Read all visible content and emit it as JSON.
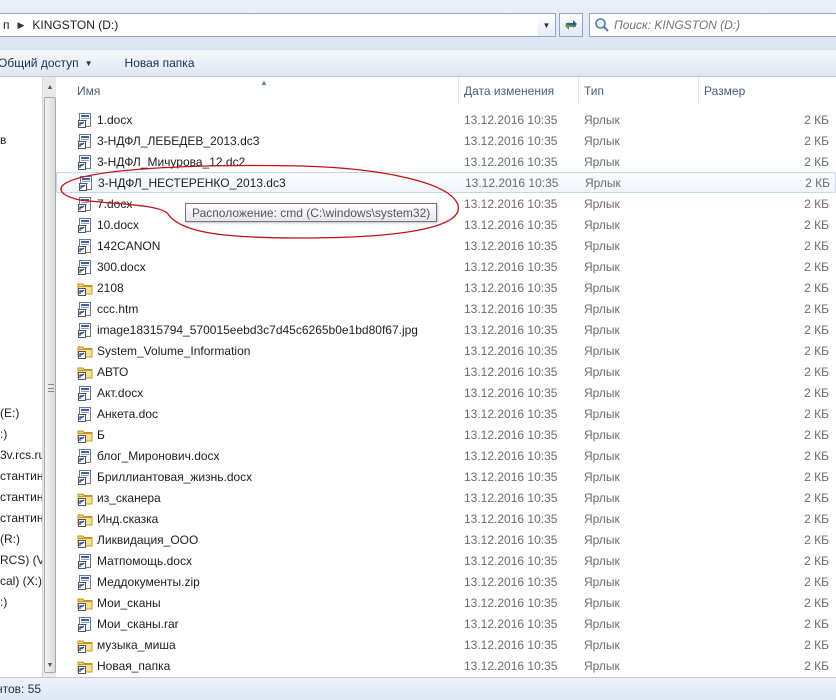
{
  "address": {
    "crumbs": [
      "п",
      "KINGSTON (D:)"
    ]
  },
  "search": {
    "placeholder": "Поиск: KINGSTON (D:)"
  },
  "toolbar": {
    "share_label": "Общий доступ",
    "new_folder_label": "Новая папка"
  },
  "nav": {
    "items": [
      {
        "label": "в",
        "kind": "text"
      },
      {
        "label": "(E:)",
        "kind": "drive"
      },
      {
        "label": ":)",
        "kind": "drive"
      },
      {
        "label": "3v.rcs.ru",
        "kind": "net"
      },
      {
        "label": "стантин",
        "kind": "net"
      },
      {
        "label": "стантин",
        "kind": "net"
      },
      {
        "label": "стантин",
        "kind": "net"
      },
      {
        "label": "(R:)",
        "kind": "drive"
      },
      {
        "label": "RCS) (V:",
        "kind": "drive"
      },
      {
        "label": "cal) (X:)",
        "kind": "drive"
      },
      {
        "label": ":)",
        "kind": "drive"
      }
    ]
  },
  "columns": {
    "name": "Имя",
    "date": "Дата изменения",
    "type": "Тип",
    "size": "Размер"
  },
  "files": [
    {
      "name": "1.docx",
      "date": "13.12.2016 10:35",
      "type": "Ярлык",
      "size": "2 КБ",
      "icon": "doc-shortcut-icon"
    },
    {
      "name": "3-НДФЛ_ЛЕБЕДЕВ_2013.dc3",
      "date": "13.12.2016 10:35",
      "type": "Ярлык",
      "size": "2 КБ",
      "icon": "doc-shortcut-icon"
    },
    {
      "name": "3-НДФЛ_Мичурова_12.dc2",
      "date": "13.12.2016 10:35",
      "type": "Ярлык",
      "size": "2 КБ",
      "icon": "doc-shortcut-icon"
    },
    {
      "name": "3-НДФЛ_НЕСТЕРЕНКО_2013.dc3",
      "date": "13.12.2016 10:35",
      "type": "Ярлык",
      "size": "2 КБ",
      "icon": "doc-shortcut-icon",
      "hover": true
    },
    {
      "name": "7.docx",
      "date": "13.12.2016 10:35",
      "type": "Ярлык",
      "size": "2 КБ",
      "icon": "doc-shortcut-icon"
    },
    {
      "name": "10.docx",
      "date": "13.12.2016 10:35",
      "type": "Ярлык",
      "size": "2 КБ",
      "icon": "doc-shortcut-icon"
    },
    {
      "name": "142CANON",
      "date": "13.12.2016 10:35",
      "type": "Ярлык",
      "size": "2 КБ",
      "icon": "doc-shortcut-icon"
    },
    {
      "name": "300.docx",
      "date": "13.12.2016 10:35",
      "type": "Ярлык",
      "size": "2 КБ",
      "icon": "doc-shortcut-icon"
    },
    {
      "name": "2108",
      "date": "13.12.2016 10:35",
      "type": "Ярлык",
      "size": "2 КБ",
      "icon": "folder-shortcut-icon"
    },
    {
      "name": "ccc.htm",
      "date": "13.12.2016 10:35",
      "type": "Ярлык",
      "size": "2 КБ",
      "icon": "doc-shortcut-icon"
    },
    {
      "name": "image18315794_570015eebd3c7d45c6265b0e1bd80f67.jpg",
      "date": "13.12.2016 10:35",
      "type": "Ярлык",
      "size": "2 КБ",
      "icon": "doc-shortcut-icon"
    },
    {
      "name": "System_Volume_Information",
      "date": "13.12.2016 10:35",
      "type": "Ярлык",
      "size": "2 КБ",
      "icon": "folder-shortcut-icon"
    },
    {
      "name": "АВТО",
      "date": "13.12.2016 10:35",
      "type": "Ярлык",
      "size": "2 КБ",
      "icon": "folder-shortcut-icon"
    },
    {
      "name": "Акт.docx",
      "date": "13.12.2016 10:35",
      "type": "Ярлык",
      "size": "2 КБ",
      "icon": "doc-shortcut-icon"
    },
    {
      "name": "Анкета.doc",
      "date": "13.12.2016 10:35",
      "type": "Ярлык",
      "size": "2 КБ",
      "icon": "doc-shortcut-icon"
    },
    {
      "name": "Б",
      "date": "13.12.2016 10:35",
      "type": "Ярлык",
      "size": "2 КБ",
      "icon": "folder-shortcut-icon"
    },
    {
      "name": "блог_Миронович.docx",
      "date": "13.12.2016 10:35",
      "type": "Ярлык",
      "size": "2 КБ",
      "icon": "doc-shortcut-icon"
    },
    {
      "name": "Бриллиантовая_жизнь.docx",
      "date": "13.12.2016 10:35",
      "type": "Ярлык",
      "size": "2 КБ",
      "icon": "doc-shortcut-icon"
    },
    {
      "name": "из_сканера",
      "date": "13.12.2016 10:35",
      "type": "Ярлык",
      "size": "2 КБ",
      "icon": "folder-shortcut-icon"
    },
    {
      "name": "Инд.сказка",
      "date": "13.12.2016 10:35",
      "type": "Ярлык",
      "size": "2 КБ",
      "icon": "folder-shortcut-icon"
    },
    {
      "name": "Ликвидация_ООО",
      "date": "13.12.2016 10:35",
      "type": "Ярлык",
      "size": "2 КБ",
      "icon": "folder-shortcut-icon"
    },
    {
      "name": "Матпомощь.docx",
      "date": "13.12.2016 10:35",
      "type": "Ярлык",
      "size": "2 КБ",
      "icon": "doc-shortcut-icon"
    },
    {
      "name": "Меддокументы.zip",
      "date": "13.12.2016 10:35",
      "type": "Ярлык",
      "size": "2 КБ",
      "icon": "doc-shortcut-icon"
    },
    {
      "name": "Мои_сканы",
      "date": "13.12.2016 10:35",
      "type": "Ярлык",
      "size": "2 КБ",
      "icon": "folder-shortcut-icon"
    },
    {
      "name": "Мои_сканы.rar",
      "date": "13.12.2016 10:35",
      "type": "Ярлык",
      "size": "2 КБ",
      "icon": "doc-shortcut-icon"
    },
    {
      "name": "музыка_миша",
      "date": "13.12.2016 10:35",
      "type": "Ярлык",
      "size": "2 КБ",
      "icon": "folder-shortcut-icon"
    },
    {
      "name": "Новая_папка",
      "date": "13.12.2016 10:35",
      "type": "Ярлык",
      "size": "2 КБ",
      "icon": "folder-shortcut-icon"
    }
  ],
  "tooltip": {
    "text": "Расположение: cmd (C:\\windows\\system32)"
  },
  "status": {
    "text": "нтов: 55"
  },
  "colors": {
    "annotation": "#c0141a",
    "selection_border": "#c9d6e6",
    "header_text": "#4c607a"
  }
}
